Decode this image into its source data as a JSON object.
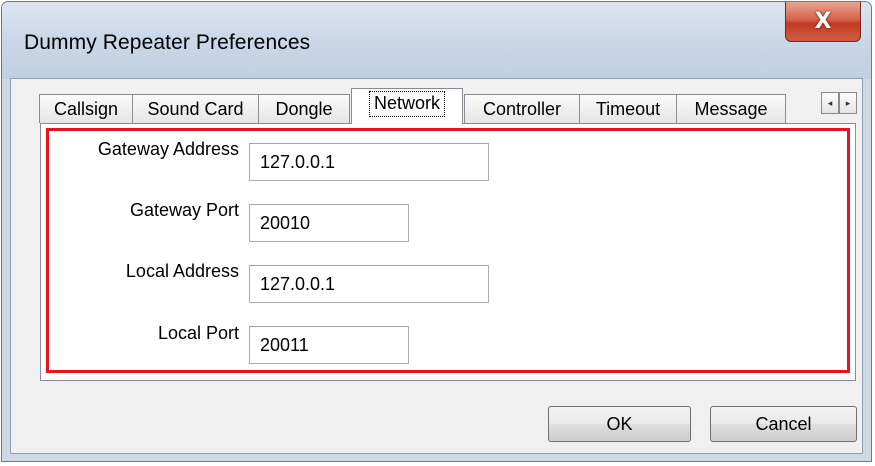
{
  "window": {
    "title": "Dummy Repeater Preferences",
    "close_glyph": "X"
  },
  "tabs": [
    {
      "label": "Callsign"
    },
    {
      "label": "Sound Card"
    },
    {
      "label": "Dongle"
    },
    {
      "label": "Network",
      "selected": true
    },
    {
      "label": "Controller"
    },
    {
      "label": "Timeout"
    },
    {
      "label": "Message"
    }
  ],
  "tab_scroll": {
    "left": "◂",
    "right": "▸"
  },
  "network": {
    "gateway_address": {
      "label": "Gateway Address",
      "value": "127.0.0.1"
    },
    "gateway_port": {
      "label": "Gateway Port",
      "value": "20010"
    },
    "local_address": {
      "label": "Local Address",
      "value": "127.0.0.1"
    },
    "local_port": {
      "label": "Local Port",
      "value": "20011"
    }
  },
  "buttons": {
    "ok": "OK",
    "cancel": "Cancel"
  },
  "colors": {
    "highlight_border": "#e8141d",
    "close_button": "#c23a22"
  }
}
